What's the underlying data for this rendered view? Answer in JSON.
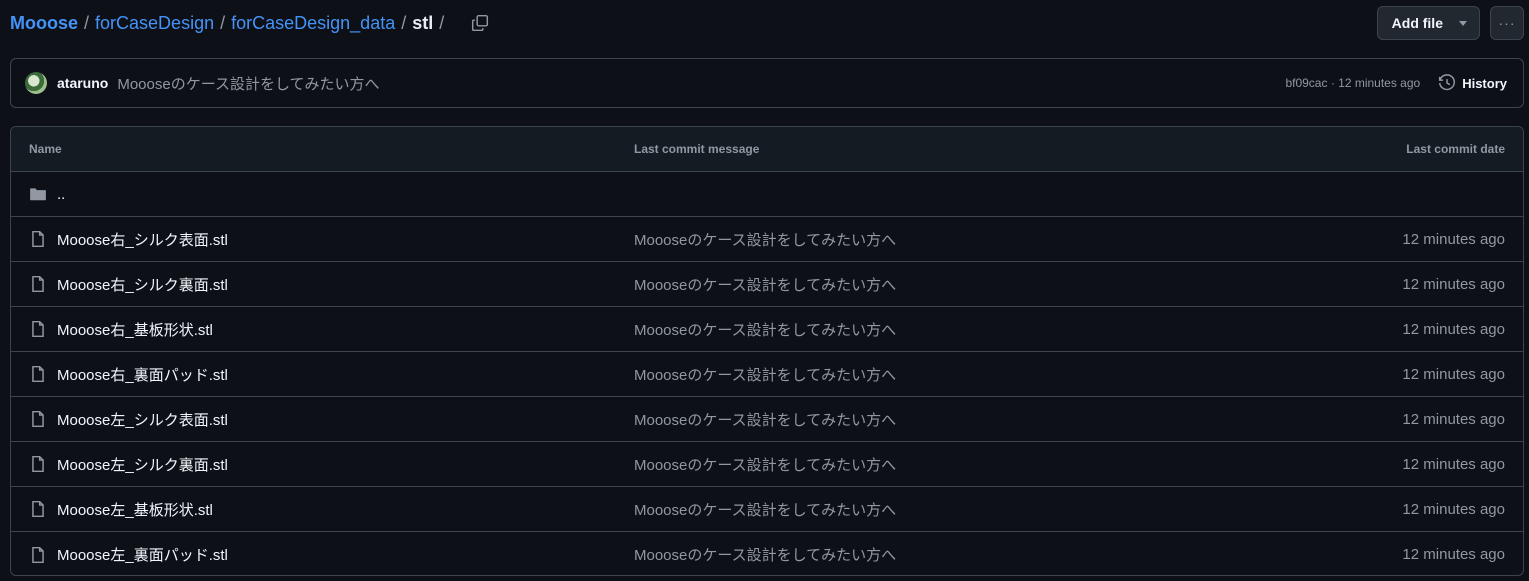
{
  "breadcrumb": {
    "root": "Mooose",
    "parts": [
      "forCaseDesign",
      "forCaseDesign_data"
    ],
    "current": "stl",
    "separator": "/"
  },
  "actions": {
    "add_file_label": "Add file",
    "more_label": "···"
  },
  "commit": {
    "author": "ataruno",
    "message": "Moooseのケース設計をしてみたい方へ",
    "meta": "bf09cac · 12 minutes ago",
    "history_label": "History"
  },
  "table": {
    "headers": [
      "Name",
      "Last commit message",
      "Last commit date"
    ],
    "parent_dir": "..",
    "rows": [
      {
        "name": "Mooose右_シルク表面.stl",
        "message": "Moooseのケース設計をしてみたい方へ",
        "date": "12 minutes ago"
      },
      {
        "name": "Mooose右_シルク裏面.stl",
        "message": "Moooseのケース設計をしてみたい方へ",
        "date": "12 minutes ago"
      },
      {
        "name": "Mooose右_基板形状.stl",
        "message": "Moooseのケース設計をしてみたい方へ",
        "date": "12 minutes ago"
      },
      {
        "name": "Mooose右_裏面パッド.stl",
        "message": "Moooseのケース設計をしてみたい方へ",
        "date": "12 minutes ago"
      },
      {
        "name": "Mooose左_シルク表面.stl",
        "message": "Moooseのケース設計をしてみたい方へ",
        "date": "12 minutes ago"
      },
      {
        "name": "Mooose左_シルク裏面.stl",
        "message": "Moooseのケース設計をしてみたい方へ",
        "date": "12 minutes ago"
      },
      {
        "name": "Mooose左_基板形状.stl",
        "message": "Moooseのケース設計をしてみたい方へ",
        "date": "12 minutes ago"
      },
      {
        "name": "Mooose左_裏面パッド.stl",
        "message": "Moooseのケース設計をしてみたい方へ",
        "date": "12 minutes ago"
      }
    ]
  },
  "icons": {
    "copy": "copy-icon",
    "history": "history-icon",
    "folder": "folder-icon",
    "file": "file-icon"
  },
  "colors": {
    "background": "#0d1117",
    "link": "#4493f8",
    "border": "#3d444d",
    "muted": "#9198a1",
    "text": "#f0f6fc"
  }
}
